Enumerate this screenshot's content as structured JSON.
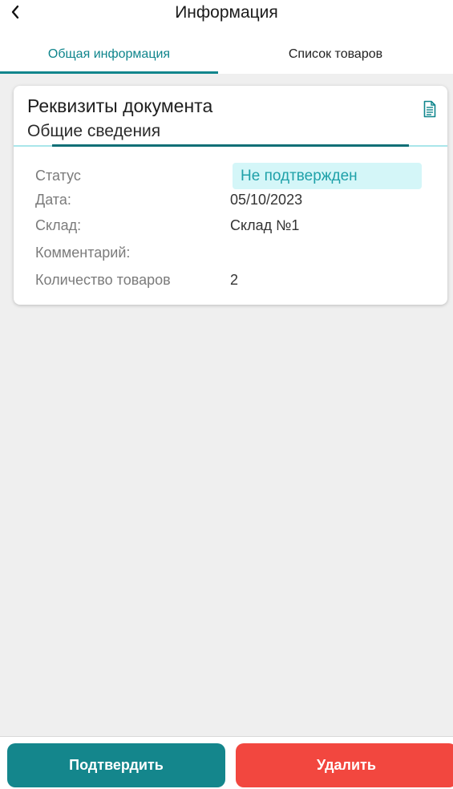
{
  "header": {
    "title": "Информация",
    "back_icon": "chevron-left-icon"
  },
  "tabs": [
    {
      "label": "Общая информация",
      "active": true
    },
    {
      "label": "Список товаров",
      "active": false
    }
  ],
  "card": {
    "title": "Реквизиты документа",
    "subtitle": "Общие сведения",
    "icon": "document-icon",
    "fields": {
      "status": {
        "label": "Статус",
        "value": "Не подтвержден"
      },
      "date": {
        "label": "Дата:",
        "value": "05/10/2023"
      },
      "warehouse": {
        "label": "Склад:",
        "value": "Склад №1"
      },
      "comment": {
        "label": "Комментарий:",
        "value": ""
      },
      "items_count": {
        "label": "Количество товаров",
        "value": "2"
      }
    }
  },
  "actions": {
    "confirm_label": "Подтвердить",
    "delete_label": "Удалить"
  },
  "colors": {
    "accent": "#0f858c",
    "status_bg": "#d4f6f8",
    "status_text": "#1fa1a9",
    "delete": "#f2473f",
    "confirm": "#14868c"
  }
}
